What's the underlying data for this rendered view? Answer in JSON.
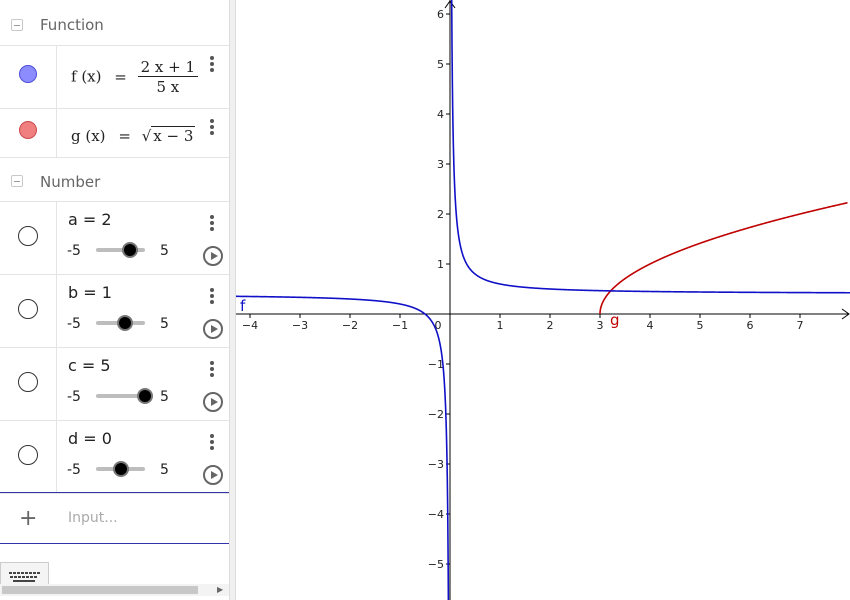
{
  "algebra": {
    "function_section": {
      "title": "Function"
    },
    "f": {
      "name": "f (x)",
      "equals": "=",
      "numerator": "2 x + 1",
      "denominator": "5 x",
      "color": "#7c7cff"
    },
    "g": {
      "name": "g (x)",
      "equals": "=",
      "radical": "√",
      "radicand": "x − 3",
      "color": "#ef7b7b"
    },
    "number_section": {
      "title": "Number"
    },
    "sliders": [
      {
        "label": "a = 2",
        "min": "-5",
        "max": "5",
        "value": 2
      },
      {
        "label": "b = 1",
        "min": "-5",
        "max": "5",
        "value": 1
      },
      {
        "label": "c = 5",
        "min": "-5",
        "max": "5",
        "value": 5
      },
      {
        "label": "d = 0",
        "min": "-5",
        "max": "5",
        "value": 0
      }
    ],
    "input": {
      "plus": "+",
      "placeholder": "Input..."
    }
  },
  "graph": {
    "x_ticks": [
      "−4",
      "−3",
      "−2",
      "−1",
      "0",
      "1",
      "2",
      "3",
      "4",
      "5",
      "6",
      "7"
    ],
    "y_ticks": [
      "6",
      "5",
      "4",
      "3",
      "2",
      "1",
      "−1",
      "−2",
      "−3",
      "−4",
      "−5"
    ],
    "f_label": "f",
    "g_label": "g",
    "f_color": "#1010c8",
    "g_color": "#c00000"
  },
  "chart_data": {
    "type": "line",
    "series": [
      {
        "name": "f",
        "expression": "(2x+1)/(5x)"
      },
      {
        "name": "g",
        "expression": "sqrt(x-3)"
      }
    ],
    "xlim": [
      -4.3,
      7.9
    ],
    "ylim": [
      -5.6,
      6.3
    ],
    "grid": false
  }
}
